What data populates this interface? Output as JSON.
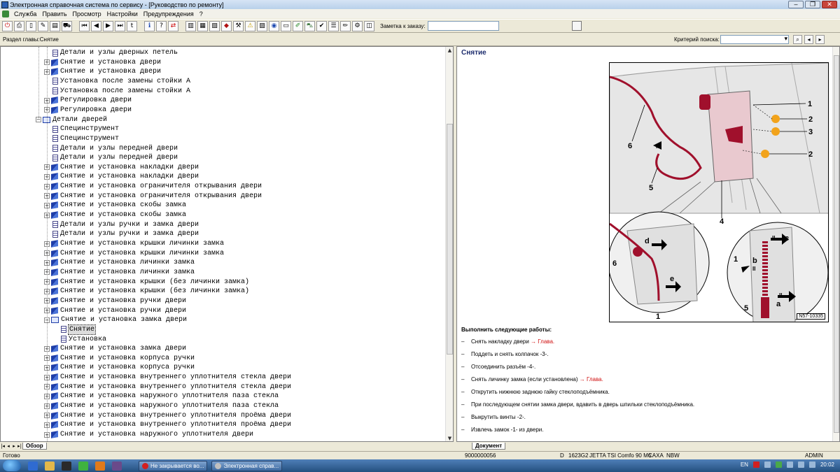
{
  "window": {
    "title": "Электронная справочная система по сервису - [Руководство по ремонту]"
  },
  "menu": [
    "Служба",
    "Править",
    "Просмотр",
    "Настройки",
    "Предупреждения",
    "?"
  ],
  "toolbar": {
    "order_label": "Заметка к заказу:",
    "order_value": ""
  },
  "section": {
    "label": "Раздел главы:Снятие",
    "criteria_label": "Критерий поиска:",
    "criteria_value": ""
  },
  "tree": [
    {
      "label": "Детали и узлы дверных петель",
      "icon": "doc",
      "level": 2,
      "expander": ""
    },
    {
      "label": "Снятие и установка двери",
      "icon": "book",
      "level": 2,
      "expander": "+"
    },
    {
      "label": "Снятие и установка двери",
      "icon": "book",
      "level": 2,
      "expander": "+"
    },
    {
      "label": "Установка после замены стойки А",
      "icon": "doc",
      "level": 2,
      "expander": ""
    },
    {
      "label": "Установка после замены стойки А",
      "icon": "doc",
      "level": 2,
      "expander": ""
    },
    {
      "label": "Регулировка двери",
      "icon": "book",
      "level": 2,
      "expander": "+"
    },
    {
      "label": "Регулировка двери",
      "icon": "book",
      "level": 2,
      "expander": "+"
    },
    {
      "label": "Детали дверей",
      "icon": "open",
      "level": 1,
      "expander": "−"
    },
    {
      "label": "Специнструмент",
      "icon": "doc",
      "level": 2,
      "expander": ""
    },
    {
      "label": "Специнструмент",
      "icon": "doc",
      "level": 2,
      "expander": ""
    },
    {
      "label": "Детали и узлы передней двери",
      "icon": "doc",
      "level": 2,
      "expander": ""
    },
    {
      "label": "Детали и узлы передней двери",
      "icon": "doc",
      "level": 2,
      "expander": ""
    },
    {
      "label": "Снятие и установка накладки двери",
      "icon": "book",
      "level": 2,
      "expander": "+"
    },
    {
      "label": "Снятие и установка накладки двери",
      "icon": "book",
      "level": 2,
      "expander": "+"
    },
    {
      "label": "Снятие и установка ограничителя открывания двери",
      "icon": "book",
      "level": 2,
      "expander": "+"
    },
    {
      "label": "Снятие и установка ограничителя открывания двери",
      "icon": "book",
      "level": 2,
      "expander": "+"
    },
    {
      "label": "Снятие и установка скобы замка",
      "icon": "book",
      "level": 2,
      "expander": "+"
    },
    {
      "label": "Снятие и установка скобы замка",
      "icon": "book",
      "level": 2,
      "expander": "+"
    },
    {
      "label": "Детали и узлы ручки и замка двери",
      "icon": "doc",
      "level": 2,
      "expander": ""
    },
    {
      "label": "Детали и узлы ручки и замка двери",
      "icon": "doc",
      "level": 2,
      "expander": ""
    },
    {
      "label": "Снятие и установка крышки личинки замка",
      "icon": "book",
      "level": 2,
      "expander": "+"
    },
    {
      "label": "Снятие и установка крышки личинки замка",
      "icon": "book",
      "level": 2,
      "expander": "+"
    },
    {
      "label": "Снятие и установка личинки замка",
      "icon": "book",
      "level": 2,
      "expander": "+"
    },
    {
      "label": "Снятие и установка личинки замка",
      "icon": "book",
      "level": 2,
      "expander": "+"
    },
    {
      "label": "Снятие и установка крышки (без личинки замка)",
      "icon": "book",
      "level": 2,
      "expander": "+"
    },
    {
      "label": "Снятие и установка крышки (без личинки замка)",
      "icon": "book",
      "level": 2,
      "expander": "+"
    },
    {
      "label": "Снятие и установка ручки двери",
      "icon": "book",
      "level": 2,
      "expander": "+"
    },
    {
      "label": "Снятие и установка ручки двери",
      "icon": "book",
      "level": 2,
      "expander": "+"
    },
    {
      "label": "Снятие и установка замка двери",
      "icon": "open",
      "level": 2,
      "expander": "−"
    },
    {
      "label": "Снятие",
      "icon": "doc",
      "level": 3,
      "expander": "",
      "selected": true
    },
    {
      "label": "Установка",
      "icon": "doc",
      "level": 3,
      "expander": ""
    },
    {
      "label": "Снятие и установка замка двери",
      "icon": "book",
      "level": 2,
      "expander": "+"
    },
    {
      "label": "Снятие и установка корпуса ручки",
      "icon": "book",
      "level": 2,
      "expander": "+"
    },
    {
      "label": "Снятие и установка корпуса ручки",
      "icon": "book",
      "level": 2,
      "expander": "+"
    },
    {
      "label": "Снятие и установка внутреннего уплотнителя стекла двери",
      "icon": "book",
      "level": 2,
      "expander": "+"
    },
    {
      "label": "Снятие и установка внутреннего уплотнителя стекла двери",
      "icon": "book",
      "level": 2,
      "expander": "+"
    },
    {
      "label": "Снятие и установка наружного уплотнителя паза стекла",
      "icon": "book",
      "level": 2,
      "expander": "+"
    },
    {
      "label": "Снятие и установка наружного уплотнителя паза стекла",
      "icon": "book",
      "level": 2,
      "expander": "+"
    },
    {
      "label": "Снятие и установка внутреннего уплотнителя проёма двери",
      "icon": "book",
      "level": 2,
      "expander": "+"
    },
    {
      "label": "Снятие и установка внутреннего уплотнителя проёма двери",
      "icon": "book",
      "level": 2,
      "expander": "+"
    },
    {
      "label": "Снятие и установка наружного уплотнителя двери",
      "icon": "book",
      "level": 2,
      "expander": "+"
    }
  ],
  "left_tab": "Обзор",
  "doc": {
    "title": "Снятие",
    "figure_caption": "N57-10335",
    "callouts": [
      "1",
      "2",
      "3",
      "2",
      "4",
      "5",
      "6",
      "6",
      "1",
      "1",
      "5",
      "a",
      "b",
      "c",
      "d",
      "e",
      "II",
      "II",
      "II",
      "II"
    ],
    "instructions_head": "Выполнить следующие работы:",
    "steps": [
      {
        "text": "Снять накладку двери ",
        "link": "→ Глава."
      },
      {
        "text": "Поддеть и снять колпачок -3-.",
        "link": ""
      },
      {
        "text": "Отсоединить разъём -4-.",
        "link": ""
      },
      {
        "text": "Снять личинку замка (если установлена) ",
        "link": "→ Глава."
      },
      {
        "text": "Открутить нижнюю заднюю гайку стеклоподъёмника.",
        "link": ""
      },
      {
        "text": "При последующем снятии замка двери, вдавить в дверь шпильки стеклоподъёмника.",
        "link": ""
      },
      {
        "text": "Выкрутить винты -2-.",
        "link": ""
      },
      {
        "text": "Извлечь замок -1- из двери.",
        "link": ""
      }
    ]
  },
  "right_tab": "Документ",
  "status": {
    "left": "Готово",
    "order_no": "9000000056",
    "d": "D",
    "code": "1623G2",
    "model": "JETTA TSI Comfo 90 M6",
    "caxa": "CAXA",
    "nbw": "NBW",
    "user": "ADMIN"
  },
  "taskbar": {
    "tasks": [
      "Не закрывается во...",
      "Электронная справ..."
    ],
    "lang": "EN",
    "time": "20:02"
  },
  "colors": {
    "accent_red": "#d01010",
    "title_blue": "#1e2d6e",
    "part_red": "#a0102c"
  }
}
